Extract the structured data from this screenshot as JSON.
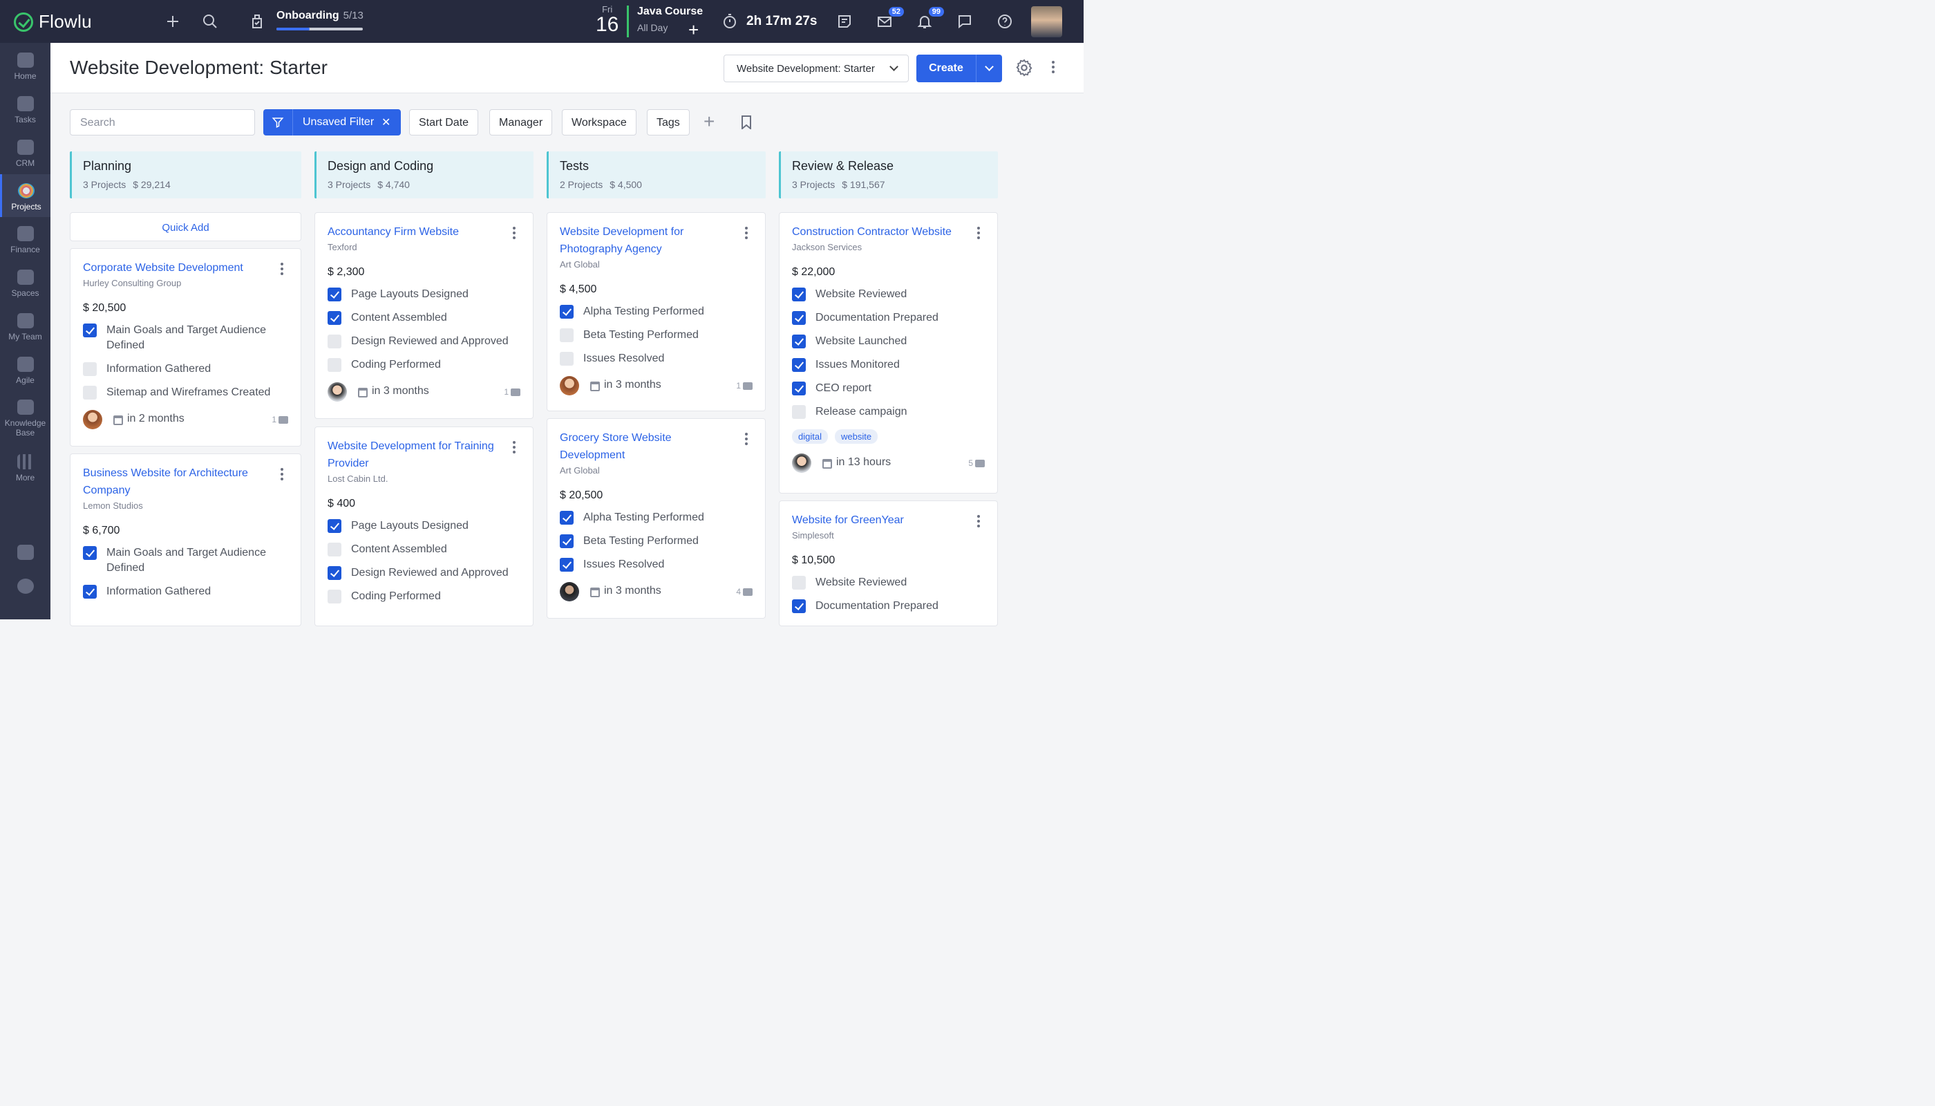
{
  "app": {
    "name": "Flowlu"
  },
  "topbar": {
    "onboarding_label": "Onboarding",
    "onboarding_count": "5/13",
    "onboarding_progress": 0.38,
    "date_dow": "Fri",
    "date_day": "16",
    "event_title": "Java Course",
    "event_sub": "All Day",
    "timer": "2h 17m 27s",
    "mail_badge": "52",
    "notif_badge": "99"
  },
  "sidebar": {
    "items": [
      {
        "label": "Home",
        "icon": "home-icon"
      },
      {
        "label": "Tasks",
        "icon": "tasks-icon"
      },
      {
        "label": "CRM",
        "icon": "crm-icon"
      },
      {
        "label": "Projects",
        "icon": "projects-icon"
      },
      {
        "label": "Finance",
        "icon": "finance-icon"
      },
      {
        "label": "Spaces",
        "icon": "spaces-icon"
      },
      {
        "label": "My Team",
        "icon": "team-icon"
      },
      {
        "label": "Agile",
        "icon": "agile-icon"
      },
      {
        "label": "Knowledge Base",
        "icon": "knowledge-icon"
      },
      {
        "label": "More",
        "icon": "grid-icon"
      }
    ]
  },
  "header": {
    "title": "Website Development: Starter",
    "workspace_select": "Website Development: Starter",
    "create_label": "Create"
  },
  "filters": {
    "search_placeholder": "Search",
    "active_filter": "Unsaved Filter",
    "chips": [
      "Start Date",
      "Manager",
      "Workspace",
      "Tags"
    ]
  },
  "board": {
    "quick_add": "Quick Add",
    "columns": [
      {
        "title": "Planning",
        "projects": "3 Projects",
        "amount": "$ 29,214"
      },
      {
        "title": "Design and Coding",
        "projects": "3 Projects",
        "amount": "$ 4,740"
      },
      {
        "title": "Tests",
        "projects": "2 Projects",
        "amount": "$ 4,500"
      },
      {
        "title": "Review & Release",
        "projects": "3 Projects",
        "amount": "$ 191,567"
      }
    ],
    "cards": {
      "c1": {
        "title": "Corporate Website Development",
        "client": "Hurley Consulting Group",
        "amount": "$ 20,500",
        "tasks": [
          "Main Goals and Target Audience Defined",
          "Information Gathered",
          "Sitemap and Wireframes Created"
        ],
        "due": "in 2 months",
        "comments": "1"
      },
      "c2": {
        "title": "Business Website for Architecture Company",
        "client": "Lemon Studios",
        "amount": "$ 6,700",
        "tasks": [
          "Main Goals and Target Audience Defined",
          "Information Gathered"
        ]
      },
      "c3": {
        "title": "Accountancy Firm Website",
        "client": "Texford",
        "amount": "$ 2,300",
        "tasks": [
          "Page Layouts Designed",
          "Content Assembled",
          "Design Reviewed and Approved",
          "Coding Performed"
        ],
        "due": "in 3 months",
        "comments": "1"
      },
      "c4": {
        "title": "Website Development for Training Provider",
        "client": "Lost Cabin Ltd.",
        "amount": "$ 400",
        "tasks": [
          "Page Layouts Designed",
          "Content Assembled",
          "Design Reviewed and Approved",
          "Coding Performed"
        ]
      },
      "c5": {
        "title": "Website Development for Photography Agency",
        "client": "Art Global",
        "amount": "$ 4,500",
        "tasks": [
          "Alpha Testing Performed",
          "Beta Testing Performed",
          "Issues Resolved"
        ],
        "due": "in 3 months",
        "comments": "1"
      },
      "c6": {
        "title": "Grocery Store Website Development",
        "client": "Art Global",
        "amount": "$ 20,500",
        "tasks": [
          "Alpha Testing Performed",
          "Beta Testing Performed",
          "Issues Resolved"
        ],
        "due": "in 3 months",
        "comments": "4"
      },
      "c7": {
        "title": "Construction Contractor Website",
        "client": "Jackson Services",
        "amount": "$ 22,000",
        "tasks": [
          "Website Reviewed",
          "Documentation Prepared",
          "Website Launched",
          "Issues Monitored",
          "CEO report",
          "Release campaign"
        ],
        "tags": [
          "digital",
          "website"
        ],
        "due": "in 13 hours",
        "comments": "5"
      },
      "c8": {
        "title": "Website for GreenYear",
        "client": "Simplesoft",
        "amount": "$ 10,500",
        "tasks": [
          "Website Reviewed",
          "Documentation Prepared"
        ]
      }
    }
  }
}
